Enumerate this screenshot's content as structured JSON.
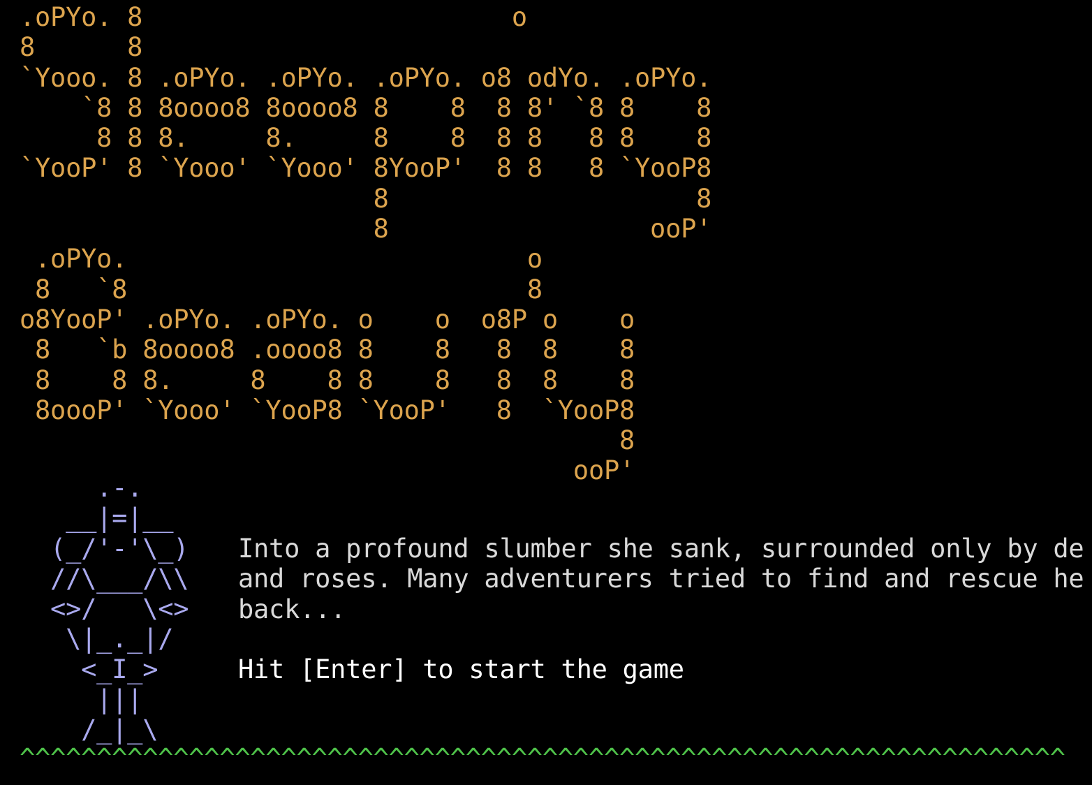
{
  "title_art": ".oPYo. 8                        o\n8      8\n`Yooo. 8 .oPYo. .oPYo. .oPYo. o8 odYo. .oPYo.\n    `8 8 8oooo8 8oooo8 8    8  8 8' `8 8    8\n     8 8 8.     8.     8    8  8 8   8 8    8\n`YooP' 8 `Yooo' `Yooo' 8YooP'  8 8   8 `YooP8\n                       8                    8\n                       8                 ooP'\n .oPYo.                          o\n 8   `8                          8\no8YooP' .oPYo. .oPYo. o    o  o8P o    o\n 8   `b 8oooo8 .oooo8 8    8   8  8    8\n 8    8 8.     8    8 8    8   8  8    8\n 8oooP' `Yooo' `YooP8 `YooP'   8  `YooP8\n                                       8\n                                    ooP'",
  "knight_art": "     .-.\n   __|=|__\n  (_/'-'\\_)\n  //\\___/\\\\\n  <>/   \\<>\n   \\|_._|/\n    <_I_>\n     |||\n    /_|_\\",
  "story": {
    "text": "Into a profound slumber she sank, surrounded only by de\nand roses. Many adventurers tried to find and rescue he\nback..."
  },
  "prompt": {
    "text": "Hit [Enter] to start the game"
  },
  "grass": "^^^^^^^^^^^^^^^^^^^^^^^^^^^^^^^^^^^^^^^^^^^^^^^^^^^^^^^^^^^^^^^^^^^^",
  "colors": {
    "background": "#000000",
    "title": "#dca44e",
    "knight": "#a9a9ee",
    "story": "#d9d9d9",
    "prompt": "#ffffff",
    "grass": "#4fc24a"
  }
}
